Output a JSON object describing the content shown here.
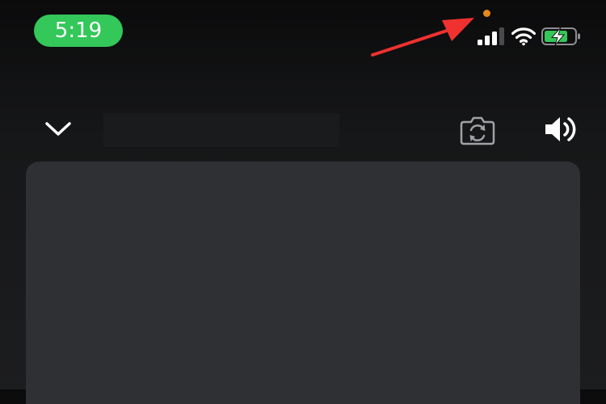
{
  "status_bar": {
    "time": "5:19",
    "time_pill_color": "#34c759",
    "privacy_indicator_color": "#e38a1c",
    "battery_fill_color": "#34c759",
    "icons": [
      "signal-icon",
      "wifi-icon",
      "battery-charging-icon"
    ]
  },
  "annotation": {
    "arrow_color": "#f0312f"
  },
  "controls": {
    "icons": [
      "chevron-down-icon",
      "camera-flip-icon",
      "speaker-icon"
    ]
  }
}
